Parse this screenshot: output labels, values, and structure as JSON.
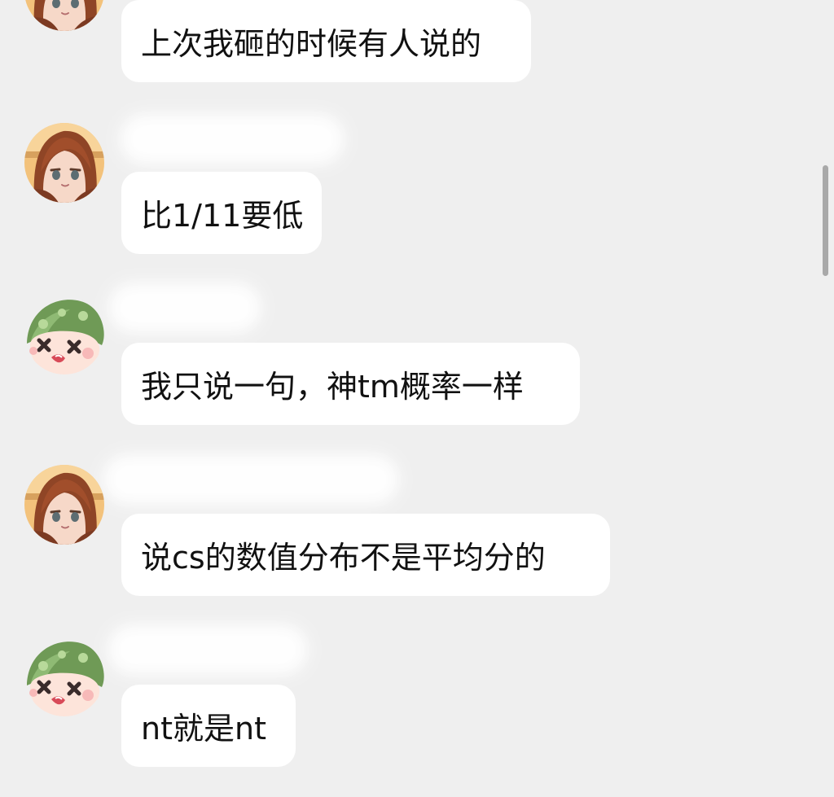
{
  "messages": [
    {
      "sender": "girl",
      "text": "上次我砸的时候有人说的"
    },
    {
      "sender": "girl",
      "text": "比1/11要低"
    },
    {
      "sender": "mushroom",
      "text": "我只说一句，神tm概率一样"
    },
    {
      "sender": "girl",
      "text": "说cs的数值分布不是平均分的"
    },
    {
      "sender": "mushroom",
      "text": "nt就是nt"
    }
  ],
  "colors": {
    "background": "#efefef",
    "bubble": "#ffffff",
    "text": "#111111",
    "scrollbar": "#a9a9a9"
  },
  "icons": {
    "girl_avatar": "anime-girl-avatar",
    "mushroom_avatar": "green-mushroom-avatar"
  }
}
